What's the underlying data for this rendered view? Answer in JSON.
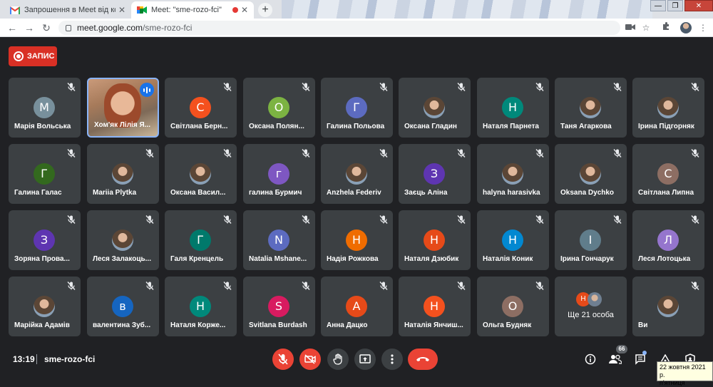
{
  "browser": {
    "tabs": [
      {
        "title": "Запрошення в Meet від користу",
        "favicon": "gmail-icon"
      },
      {
        "title": "Meet: \"sme-rozo-fci\"",
        "favicon": "meet-icon"
      }
    ],
    "url_host": "meet.google.com",
    "url_path": "/sme-rozo-fci"
  },
  "recording": {
    "label": "ЗАПИС",
    "color": "#d93025"
  },
  "participants": [
    {
      "name": "Марія Вольська",
      "initial": "М",
      "color": "#78909c"
    },
    {
      "name": "Хом'як Лілія Я...",
      "initial": "",
      "color": "",
      "video": true,
      "speaking": true
    },
    {
      "name": "Світлана Берн...",
      "initial": "С",
      "color": "#f4511e"
    },
    {
      "name": "Оксана Полян...",
      "initial": "О",
      "color": "#7cb342"
    },
    {
      "name": "Галина Польова",
      "initial": "Г",
      "color": "#5c6bc0"
    },
    {
      "name": "Оксана Гладин",
      "initial": "",
      "color": "",
      "photo": true
    },
    {
      "name": "Наталя Парнета",
      "initial": "Н",
      "color": "#00897b"
    },
    {
      "name": "Таня Агаркова",
      "initial": "",
      "color": "",
      "photo": true
    },
    {
      "name": "Ірина Підгорняк",
      "initial": "",
      "color": "",
      "photo": true
    },
    {
      "name": "Галина Галас",
      "initial": "Г",
      "color": "#33691e"
    },
    {
      "name": "Mariia Plytka",
      "initial": "",
      "color": "",
      "photo": true
    },
    {
      "name": "Оксана Васил...",
      "initial": "",
      "color": "",
      "photo": true
    },
    {
      "name": "галина Бурмич",
      "initial": "г",
      "color": "#7e57c2"
    },
    {
      "name": "Anzhela Federiv",
      "initial": "",
      "color": "",
      "photo": true
    },
    {
      "name": "Заєць Аліна",
      "initial": "З",
      "color": "#5e35b1"
    },
    {
      "name": "halyna harasivka",
      "initial": "",
      "color": "",
      "photo": true
    },
    {
      "name": "Oksana Dychko",
      "initial": "",
      "color": "",
      "photo": true
    },
    {
      "name": "Світлана Липна",
      "initial": "С",
      "color": "#8d6e63"
    },
    {
      "name": "Зоряна Прова...",
      "initial": "З",
      "color": "#5e35b1"
    },
    {
      "name": "Леся Залакоць...",
      "initial": "",
      "color": "",
      "photo": true
    },
    {
      "name": "Галя Кренцель",
      "initial": "Г",
      "color": "#00796b"
    },
    {
      "name": "Natalia Mshane...",
      "initial": "N",
      "color": "#5c6bc0"
    },
    {
      "name": "Надія Рожкова",
      "initial": "Н",
      "color": "#ef6c00"
    },
    {
      "name": "Наталя Дзюбик",
      "initial": "Н",
      "color": "#e64a19"
    },
    {
      "name": "Наталія Коник",
      "initial": "Н",
      "color": "#0288d1"
    },
    {
      "name": "Ірина Гончарук",
      "initial": "І",
      "color": "#607d8b"
    },
    {
      "name": "Леся Лотоцька",
      "initial": "Л",
      "color": "#9575cd"
    },
    {
      "name": "Марійка Адамів",
      "initial": "",
      "color": "",
      "photo": true
    },
    {
      "name": "валентина Зуб...",
      "initial": "в",
      "color": "#1565c0"
    },
    {
      "name": "Наталя Корже...",
      "initial": "Н",
      "color": "#00897b"
    },
    {
      "name": "Svitlana Burdash",
      "initial": "S",
      "color": "#d81b60"
    },
    {
      "name": "Анна Дацко",
      "initial": "А",
      "color": "#e64a19"
    },
    {
      "name": "Наталія Янчиш...",
      "initial": "Н",
      "color": "#f4511e"
    },
    {
      "name": "Ольга Будняк",
      "initial": "О",
      "color": "#8d6e63"
    },
    {
      "name": "Ще 21 особа",
      "initial": "Н",
      "color": "#e64a19",
      "more": true
    },
    {
      "name": "Ви",
      "initial": "",
      "color": "",
      "photo": true
    }
  ],
  "bottom": {
    "time": "13:19",
    "meeting_code": "sme-rozo-fci",
    "people_count": "66"
  },
  "taskbar_tooltip": {
    "date": "22 жовтня 2021 р.",
    "weekday": "п'ятниця"
  }
}
